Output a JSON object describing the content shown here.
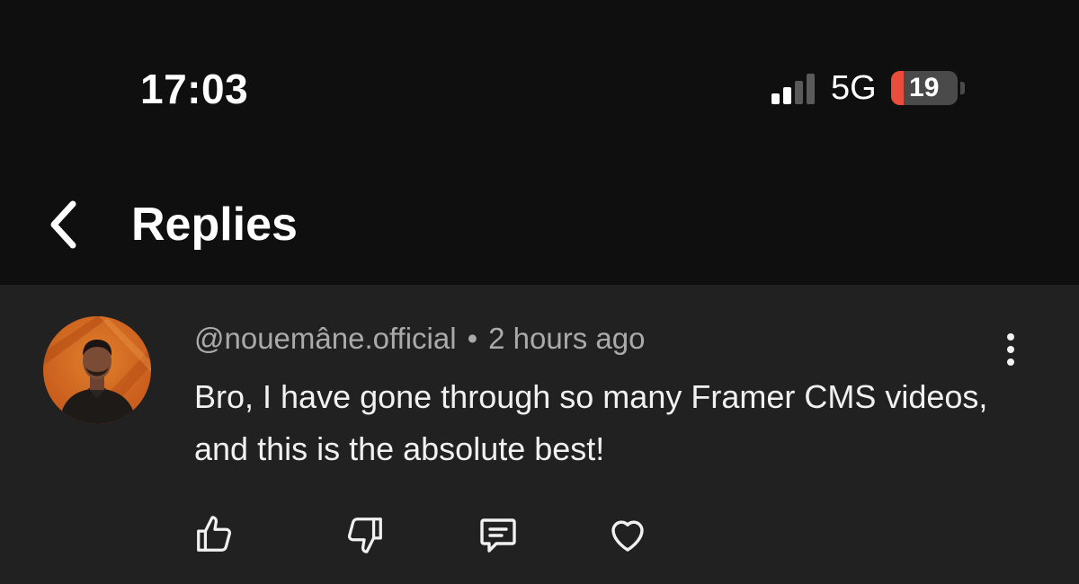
{
  "status_bar": {
    "time": "17:03",
    "network": "5G",
    "battery_level": "19",
    "signal_bars_active": 2,
    "signal_bars_total": 4
  },
  "header": {
    "title": "Replies",
    "back_icon": "chevron-left-icon"
  },
  "comment": {
    "author": "@nouemâne.official",
    "separator": "•",
    "timestamp": "2 hours ago",
    "text": "Bro, I have gone through so many Framer CMS videos, and this is the absolute best!",
    "menu_icon": "more-vertical-icon",
    "actions": [
      {
        "name": "like",
        "icon": "thumbs-up-icon"
      },
      {
        "name": "dislike",
        "icon": "thumbs-down-icon"
      },
      {
        "name": "reply",
        "icon": "comment-icon"
      },
      {
        "name": "heart",
        "icon": "heart-icon"
      }
    ]
  },
  "colors": {
    "background": "#0f0f0f",
    "comment_background": "#212121",
    "battery_low": "#eb4d3d",
    "secondary_text": "#aaaaaa",
    "primary_text": "#f1f1f1"
  }
}
